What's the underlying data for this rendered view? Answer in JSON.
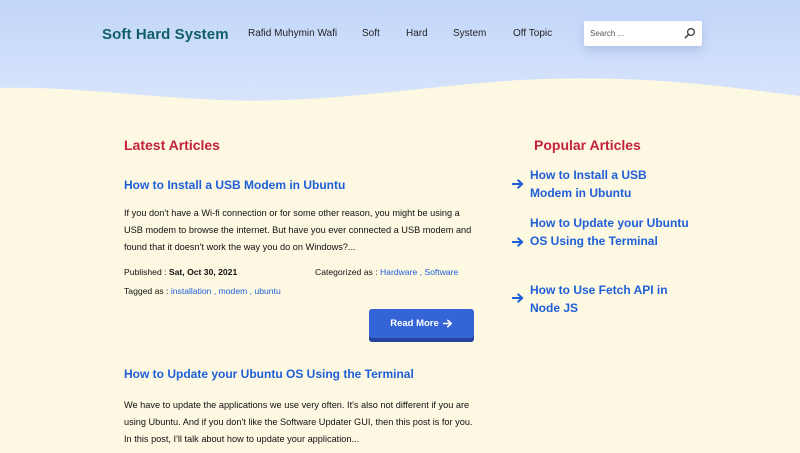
{
  "site": {
    "brand": "Soft Hard System"
  },
  "nav": {
    "items": [
      {
        "label": "Rafid Muhymin Wafi"
      },
      {
        "label": "Soft"
      },
      {
        "label": "Hard"
      },
      {
        "label": "System"
      },
      {
        "label": "Off Topic"
      }
    ]
  },
  "search": {
    "placeholder": "Search ..."
  },
  "latest": {
    "heading": "Latest Articles",
    "articles": [
      {
        "title": "How to Install a USB Modem in Ubuntu",
        "excerpt": "If you don't have a Wi-fi connection or for some other reason, you might be using a USB modem to browse the internet. But have you ever connected a USB modem and found that it doesn't work the way you do on Windows?...",
        "published_label": "Published : ",
        "published_date": "Sat, Oct 30, 2021",
        "categorized_label": "Categorized as : ",
        "categories": [
          "Hardware",
          "Software"
        ],
        "tagged_label": "Tagged as : ",
        "tags": [
          "installation",
          "modem",
          "ubuntu"
        ],
        "read_more": "Read More"
      },
      {
        "title": "How to Update your Ubuntu OS Using the Terminal",
        "excerpt": "We have to update the applications we use very often. It's also not different if you are using Ubuntu. And if you don't like the Software Updater GUI, then this post is for you. In this post, I'll talk about how to update your application..."
      }
    ]
  },
  "popular": {
    "heading": "Popular Articles",
    "items": [
      {
        "title": "How to Install a USB Modem in Ubuntu"
      },
      {
        "title": "How to Update your Ubuntu OS Using the Terminal"
      },
      {
        "title": "How to Use Fetch API in Node JS"
      }
    ]
  },
  "colors": {
    "background": "#fdf8e2",
    "header_top": "#c3d8fb",
    "header_bottom": "#d8e6fb",
    "brand": "#0f5e66",
    "accent_red": "#c3223a",
    "link_blue": "#1e5fd8",
    "button_blue": "#3564d6"
  }
}
